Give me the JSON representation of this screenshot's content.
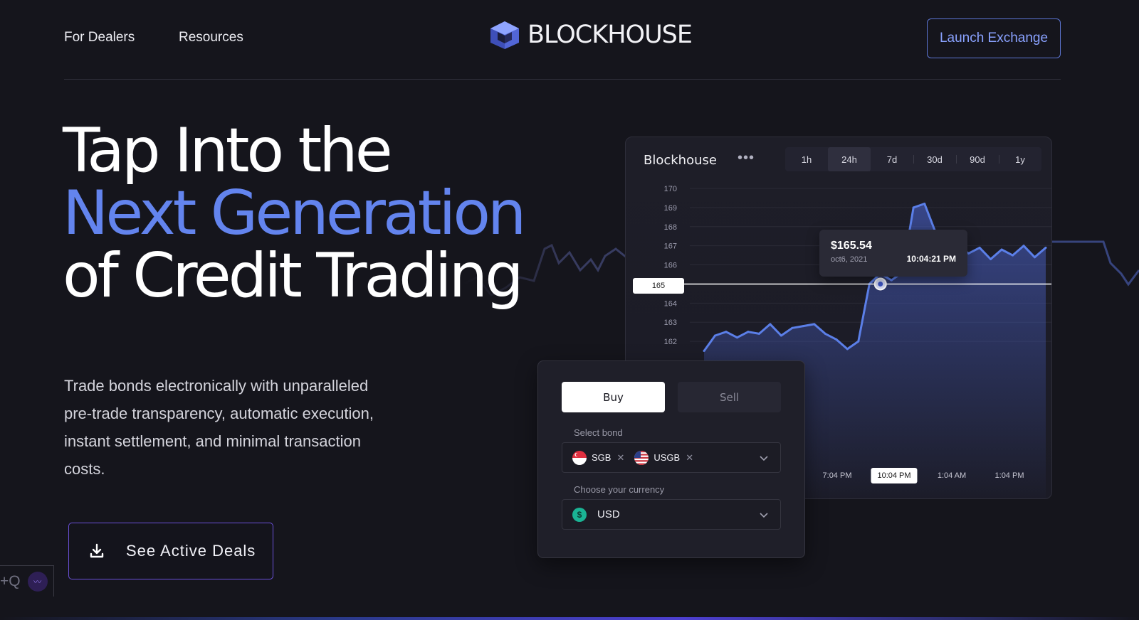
{
  "header": {
    "nav": [
      "For Dealers",
      "Resources"
    ],
    "brand": "BLOCKHOUSE",
    "launch_label": "Launch Exchange"
  },
  "hero": {
    "title_line1": "Tap Into the",
    "title_line2": "Next Generation",
    "title_line3": "of Credit Trading",
    "description": "Trade bonds electronically with unparalleled pre-trade transparency, automatic execution, instant settlement, and minimal transaction costs.",
    "cta_label": "See Active Deals"
  },
  "mini_widget": {
    "text": "+Q"
  },
  "chart_card": {
    "brand": "Blockhouse",
    "ranges": [
      "1h",
      "24h",
      "7d",
      "30d",
      "90d",
      "1y"
    ],
    "active_range": "24h",
    "tooltip": {
      "price": "$165.54",
      "date": "oct6, 2021",
      "time": "10:04:21 PM"
    },
    "crosshair_value": "165",
    "time_labels": [
      "7:04 PM",
      "10:04 PM",
      "1:04 AM",
      "1:04 PM"
    ],
    "active_time": "10:04 PM"
  },
  "chart_data": {
    "type": "line",
    "y_ticks": [
      170,
      169,
      168,
      167,
      166,
      165,
      164,
      163,
      162
    ],
    "ylim": [
      161,
      170
    ],
    "x": [
      "7:04 PM",
      "10:04 PM",
      "1:04 AM",
      "1:04 PM"
    ],
    "series": [
      {
        "values": [
          161.5,
          162.3,
          162.5,
          162.2,
          162.5,
          162.4,
          162.9,
          162.3,
          162.7,
          162.8,
          162.9,
          162.4,
          162.1,
          161.6,
          162.0,
          165.0,
          165.54,
          165.2,
          165.6,
          169.0,
          169.2,
          167.7,
          166.5,
          167.0,
          166.6,
          166.9,
          166.3,
          166.8,
          166.5,
          167.0,
          166.4,
          166.9
        ]
      }
    ],
    "colors": {
      "line": "#5b7fe8",
      "crosshair": "#ffffff"
    }
  },
  "trade_card": {
    "buy_label": "Buy",
    "sell_label": "Sell",
    "bond_label": "Select bond",
    "bonds": [
      "SGB",
      "USGB"
    ],
    "currency_label": "Choose your currency",
    "currency": "USD",
    "currency_symbol": "$"
  }
}
